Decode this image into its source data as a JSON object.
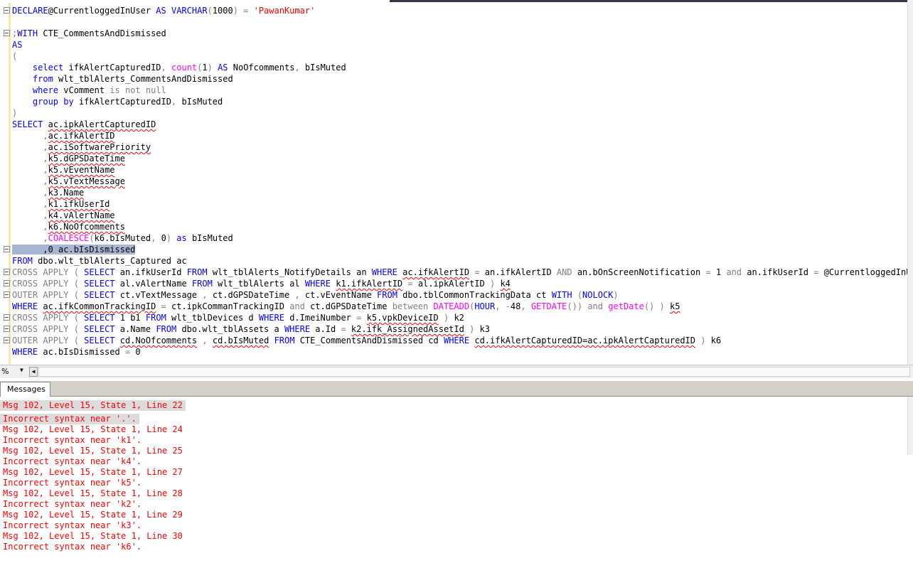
{
  "editor": {
    "lines": [
      [
        [
          "kw",
          "DECLARE"
        ],
        [
          "",
          "@CurrentloggedInUser "
        ],
        [
          "kw",
          "AS"
        ],
        [
          "kw",
          " VARCHAR"
        ],
        [
          "gy",
          "("
        ],
        [
          "",
          "1000"
        ],
        [
          "gy",
          ")"
        ],
        [
          "gy",
          " = "
        ],
        [
          "str",
          "'PawanKumar'"
        ]
      ],
      [],
      [
        [
          "gy",
          ";"
        ],
        [
          "kw",
          "WITH"
        ],
        [
          "",
          " CTE_CommentsAndDismissed"
        ]
      ],
      [
        [
          "kw",
          "AS"
        ]
      ],
      [
        [
          "gy",
          "("
        ]
      ],
      [
        [
          "",
          "    "
        ],
        [
          "kw",
          "select"
        ],
        [
          "",
          " ifkAlertCapturedID"
        ],
        [
          "gy",
          ","
        ],
        [
          "",
          " "
        ],
        [
          "fn",
          "count"
        ],
        [
          "gy",
          "("
        ],
        [
          "",
          "1"
        ],
        [
          "gy",
          ")"
        ],
        [
          "kw",
          " AS"
        ],
        [
          "",
          " NoOfcomments"
        ],
        [
          "gy",
          ","
        ],
        [
          "",
          " bIsMuted"
        ]
      ],
      [
        [
          "",
          "    "
        ],
        [
          "kw",
          "from"
        ],
        [
          "",
          " wlt_tblAlerts_CommentsAndDismissed"
        ]
      ],
      [
        [
          "",
          "    "
        ],
        [
          "kw",
          "where"
        ],
        [
          "",
          " vComment "
        ],
        [
          "gy",
          "is not null"
        ]
      ],
      [
        [
          "",
          "    "
        ],
        [
          "kw",
          "group by"
        ],
        [
          "",
          " ifkAlertCapturedID"
        ],
        [
          "gy",
          ","
        ],
        [
          "",
          " bIsMuted"
        ]
      ],
      [
        [
          "gy",
          ")"
        ]
      ],
      [
        [
          "kw",
          "SELECT"
        ],
        [
          "",
          " "
        ],
        [
          "sq",
          "ac.ipkAlertCapturedID"
        ]
      ],
      [
        [
          "",
          "      "
        ],
        [
          "gy",
          ","
        ],
        [
          "sq",
          "ac.ifkAlertID"
        ]
      ],
      [
        [
          "",
          "      "
        ],
        [
          "gy",
          ","
        ],
        [
          "sq",
          "ac.iSoftwarePriority"
        ]
      ],
      [
        [
          "",
          "      "
        ],
        [
          "gy",
          ","
        ],
        [
          "sq",
          "k5.dGPSDateTime"
        ]
      ],
      [
        [
          "",
          "      "
        ],
        [
          "gy",
          ","
        ],
        [
          "sq",
          "k5.vEventName"
        ]
      ],
      [
        [
          "",
          "      "
        ],
        [
          "gy",
          ","
        ],
        [
          "sq",
          "k5.vTextMessage"
        ]
      ],
      [
        [
          "",
          "      "
        ],
        [
          "gy",
          ","
        ],
        [
          "sq",
          "k3.Name"
        ]
      ],
      [
        [
          "",
          "      "
        ],
        [
          "gy",
          ","
        ],
        [
          "sq",
          "k1.ifkUserId"
        ]
      ],
      [
        [
          "",
          "      "
        ],
        [
          "gy",
          ","
        ],
        [
          "sq",
          "k4.vAlertName"
        ]
      ],
      [
        [
          "",
          "      "
        ],
        [
          "gy",
          ","
        ],
        [
          "sq",
          "k6.NoOfcomments"
        ]
      ],
      [
        [
          "",
          "      "
        ],
        [
          "gy",
          ","
        ],
        [
          "fn",
          "COALESCE"
        ],
        [
          "gy",
          "("
        ],
        [
          "",
          "k6.bIsMuted"
        ],
        [
          "gy",
          ","
        ],
        [
          "",
          " 0"
        ],
        [
          "gy",
          ")"
        ],
        [
          "kw",
          " as"
        ],
        [
          "",
          " bIsMuted"
        ]
      ],
      [
        [
          "sel",
          "      ,0 ac.bIsDismissed"
        ]
      ],
      [
        [
          "kw",
          "FROM"
        ],
        [
          "",
          " dbo.wlt_tblAlerts_Captured ac"
        ]
      ],
      [
        [
          "gy",
          "CROSS APPLY"
        ],
        [
          "gy",
          " ( "
        ],
        [
          "kw",
          "SELECT"
        ],
        [
          "",
          " an.ifkUserId "
        ],
        [
          "kw",
          "FROM"
        ],
        [
          "",
          " wlt_tblAlerts_NotifyDetails an "
        ],
        [
          "kw",
          "WHERE"
        ],
        [
          "",
          " "
        ],
        [
          "sq",
          "ac.ifkAlertID"
        ],
        [
          "gy",
          " = "
        ],
        [
          "",
          "an.ifkAlertID "
        ],
        [
          "gy",
          "AND"
        ],
        [
          "",
          " an.bOnScreenNotification "
        ],
        [
          "gy",
          "="
        ],
        [
          "",
          " 1 "
        ],
        [
          "gy",
          "and"
        ],
        [
          "",
          " an.ifkUserId "
        ],
        [
          "gy",
          "="
        ],
        [
          "",
          " @CurrentloggedInUser "
        ],
        [
          "gy",
          ")"
        ],
        [
          "",
          " k1"
        ]
      ],
      [
        [
          "gy",
          "CROSS APPLY"
        ],
        [
          "gy",
          " ( "
        ],
        [
          "kw",
          "SELECT"
        ],
        [
          "",
          " al.vAlertName "
        ],
        [
          "kw",
          "FROM"
        ],
        [
          "",
          " wlt_tblAlerts al "
        ],
        [
          "kw",
          "WHERE"
        ],
        [
          "",
          " "
        ],
        [
          "sq",
          "k1.ifkAlertID"
        ],
        [
          "gy",
          " = "
        ],
        [
          "",
          "al.ipkAlertID "
        ],
        [
          "gy",
          ")"
        ],
        [
          "",
          " "
        ],
        [
          "sq",
          "k4"
        ]
      ],
      [
        [
          "gy",
          "OUTER APPLY"
        ],
        [
          "gy",
          " ( "
        ],
        [
          "kw",
          "SELECT"
        ],
        [
          "",
          " ct.vTextMessage "
        ],
        [
          "gy",
          ","
        ],
        [
          "",
          " ct.dGPSDateTime "
        ],
        [
          "gy",
          ","
        ],
        [
          "",
          " ct.vEventName "
        ],
        [
          "kw",
          "FROM"
        ],
        [
          "",
          " dbo.tblCommonTrackingData ct "
        ],
        [
          "kw",
          "WITH"
        ],
        [
          "gy",
          " ("
        ],
        [
          "kw",
          "NOLOCK"
        ],
        [
          "gy",
          ")"
        ]
      ],
      [
        [
          "kw",
          "WHERE"
        ],
        [
          "",
          " "
        ],
        [
          "sq",
          "ac.ifkCommonTrackingID"
        ],
        [
          "gy",
          " = "
        ],
        [
          "",
          "ct.ipkCommanTrackingID "
        ],
        [
          "gy",
          "and"
        ],
        [
          "",
          " ct.dGPSDateTime "
        ],
        [
          "gy",
          "between"
        ],
        [
          "",
          " "
        ],
        [
          "fn",
          "DATEADD"
        ],
        [
          "gy",
          "("
        ],
        [
          "kw",
          "HOUR"
        ],
        [
          "gy",
          ","
        ],
        [
          "gy",
          " -"
        ],
        [
          "",
          "48"
        ],
        [
          "gy",
          ","
        ],
        [
          "",
          " "
        ],
        [
          "fn",
          "GETDATE"
        ],
        [
          "gy",
          "())"
        ],
        [
          "",
          " "
        ],
        [
          "gy",
          "and"
        ],
        [
          "",
          " "
        ],
        [
          "fn",
          "getDate"
        ],
        [
          "gy",
          "()"
        ],
        [
          "",
          " "
        ],
        [
          "gy",
          ")"
        ],
        [
          "",
          " "
        ],
        [
          "sq",
          "k5"
        ]
      ],
      [
        [
          "gy",
          "CROSS APPLY"
        ],
        [
          "gy",
          " ( "
        ],
        [
          "kw",
          "SELECT"
        ],
        [
          "",
          " 1 b1 "
        ],
        [
          "kw",
          "FROM"
        ],
        [
          "",
          " wlt_tblDevices d "
        ],
        [
          "kw",
          "WHERE"
        ],
        [
          "",
          " d.ImeiNumber "
        ],
        [
          "gy",
          "="
        ],
        [
          "",
          " "
        ],
        [
          "sq",
          "k5.vpkDeviceID"
        ],
        [
          "",
          " "
        ],
        [
          "gy",
          ")"
        ],
        [
          "",
          " k2"
        ]
      ],
      [
        [
          "gy",
          "CROSS APPLY"
        ],
        [
          "gy",
          " ( "
        ],
        [
          "kw",
          "SELECT"
        ],
        [
          "",
          " a.Name "
        ],
        [
          "kw",
          "FROM"
        ],
        [
          "",
          " dbo.wlt_tblAssets a "
        ],
        [
          "kw",
          "WHERE"
        ],
        [
          "",
          " a.Id "
        ],
        [
          "gy",
          "="
        ],
        [
          "",
          " "
        ],
        [
          "sq",
          "k2.ifk_AssignedAssetId"
        ],
        [
          "",
          " "
        ],
        [
          "gy",
          ")"
        ],
        [
          "",
          " k3"
        ]
      ],
      [
        [
          "gy",
          "OUTER APPLY"
        ],
        [
          "gy",
          " ( "
        ],
        [
          "kw",
          "SELECT"
        ],
        [
          "",
          " "
        ],
        [
          "sq",
          "cd.NoOfcomments"
        ],
        [
          "",
          " "
        ],
        [
          "gy",
          ","
        ],
        [
          "",
          " "
        ],
        [
          "sq",
          "cd.bIsMuted"
        ],
        [
          "",
          " "
        ],
        [
          "kw",
          "FROM"
        ],
        [
          "",
          " CTE_CommentsAndDismissed cd "
        ],
        [
          "kw",
          "WHERE"
        ],
        [
          "",
          " "
        ],
        [
          "sq",
          "cd.ifkAlertCapturedID=ac.ipkAlertCapturedID"
        ],
        [
          "",
          " "
        ],
        [
          "gy",
          ")"
        ],
        [
          "",
          " k6"
        ]
      ],
      [
        [
          "kw",
          "WHERE"
        ],
        [
          "",
          " ac.bIsDismissed "
        ],
        [
          "gy",
          "="
        ],
        [
          "",
          " 0"
        ]
      ]
    ],
    "fold_lines": [
      0,
      2,
      21,
      23,
      24,
      25,
      27,
      28,
      29
    ]
  },
  "toolbar": {
    "zoom_value": "%",
    "zoom_caret": "▼",
    "scroll_left": "◀"
  },
  "results": {
    "tab_label": "Messages",
    "messages": [
      "Msg 102, Level 15, State 1, Line 22",
      "Incorrect syntax near '.'.",
      "Msg 102, Level 15, State 1, Line 24",
      "Incorrect syntax near 'k1'.",
      "Msg 102, Level 15, State 1, Line 25",
      "Incorrect syntax near 'k4'.",
      "Msg 102, Level 15, State 1, Line 27",
      "Incorrect syntax near 'k5'.",
      "Msg 102, Level 15, State 1, Line 28",
      "Incorrect syntax near 'k2'.",
      "Msg 102, Level 15, State 1, Line 29",
      "Incorrect syntax near 'k3'.",
      "Msg 102, Level 15, State 1, Line 30",
      "Incorrect syntax near 'k6'."
    ],
    "highlighted_count": 2
  }
}
